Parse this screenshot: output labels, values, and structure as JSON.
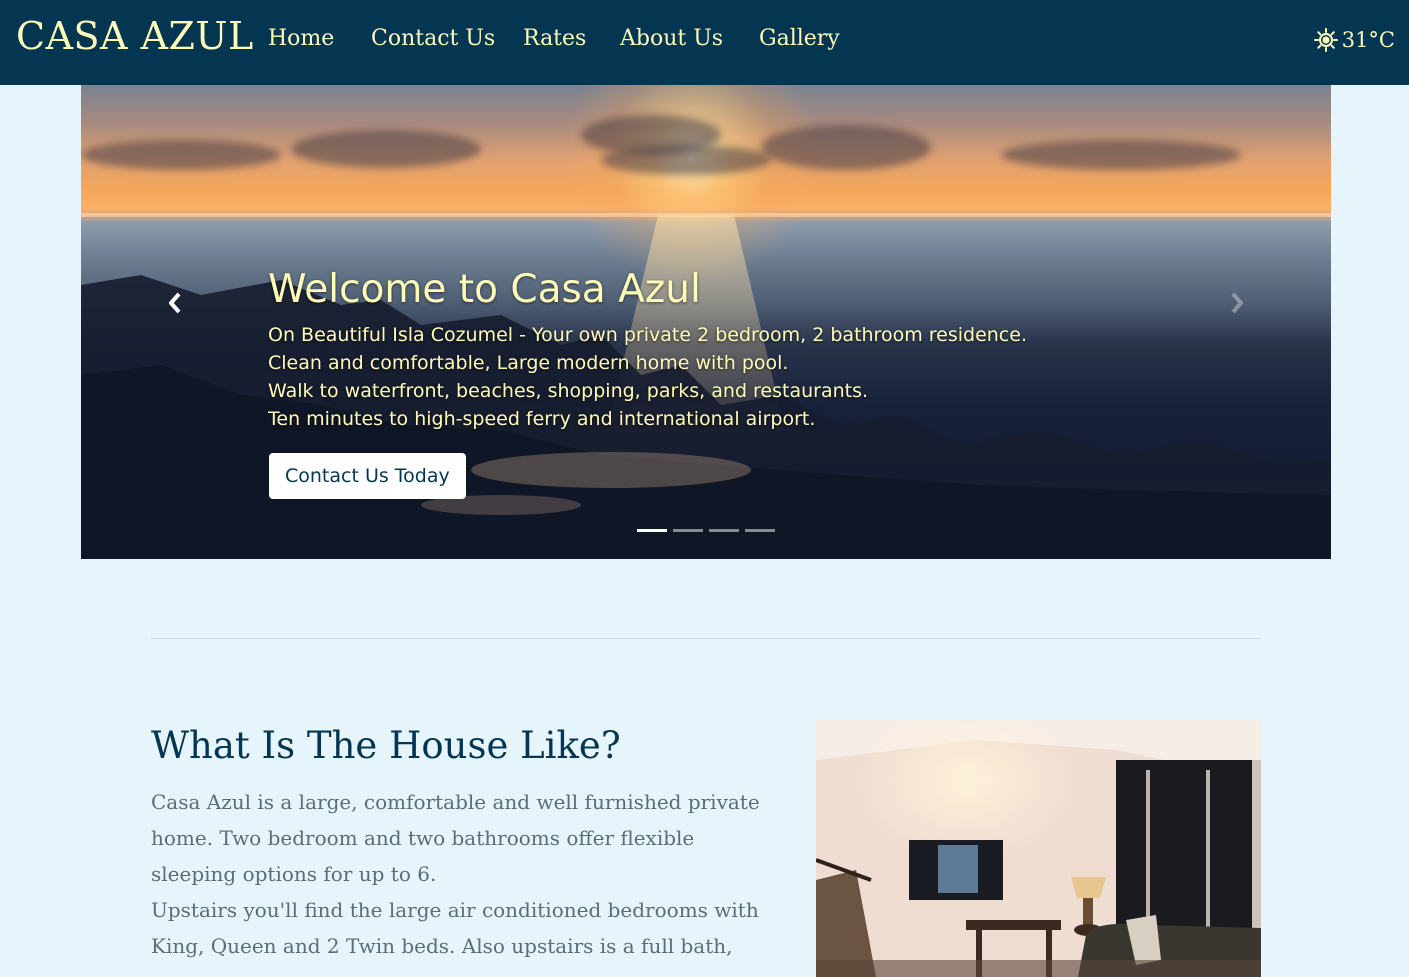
{
  "navbar": {
    "brand": "CASA AZUL",
    "items": [
      {
        "label": "Home"
      },
      {
        "label": "Contact Us"
      },
      {
        "label": "Rates"
      },
      {
        "label": "About Us"
      },
      {
        "label": "Gallery"
      }
    ],
    "weather": {
      "icon": "sun-icon",
      "temperature": "31°C"
    }
  },
  "hero": {
    "title": "Welcome to Casa Azul",
    "lines": [
      "On Beautiful Isla Cozumel - Your own private 2 bedroom, 2 bathroom residence.",
      "Clean and comfortable, Large modern home with pool.",
      "Walk to waterfront, beaches, shopping, parks, and restaurants.",
      "Ten minutes to high-speed ferry and international airport."
    ],
    "cta_label": "Contact Us Today",
    "slide_count": 4,
    "active_slide": 1
  },
  "section": {
    "title": "What Is The House Like?",
    "paragraphs": [
      "Casa Azul is a large, comfortable and well furnished private home. Two bedroom and two bathrooms offer flexible sleeping options for up to 6.",
      "Upstairs you'll find the large air conditioned bedrooms with King, Queen and 2 Twin beds. Also upstairs is a full bath,"
    ]
  },
  "colors": {
    "navbar_bg": "#043651",
    "accent_text": "#fefbb8",
    "page_bg": "#e6f4fb",
    "heading": "#043651",
    "body_text": "#5a6d78"
  }
}
